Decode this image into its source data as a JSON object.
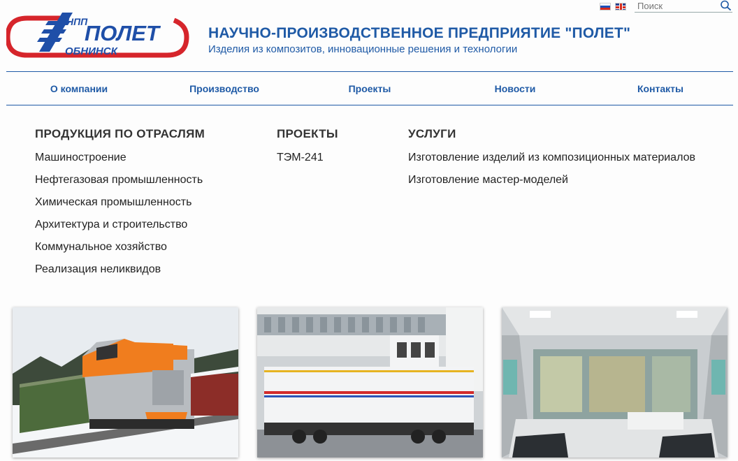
{
  "header": {
    "search_placeholder": "Поиск",
    "title": "НАУЧНО-ПРОИЗВОДСТВЕННОЕ ПРЕДПРИЯТИЕ \"ПОЛЕТ\"",
    "subtitle": "Изделия из композитов, инновационные решения и технологии",
    "logo": {
      "top_text": "НПП",
      "main_text": "ПОЛЕТ",
      "city_text": "ОБНИНСК",
      "brand_blue": "#1f4fa8",
      "brand_red": "#d6252b"
    }
  },
  "nav": {
    "items": [
      {
        "label": "О компании"
      },
      {
        "label": "Производство"
      },
      {
        "label": "Проекты"
      },
      {
        "label": "Новости"
      },
      {
        "label": "Контакты"
      }
    ]
  },
  "menu": {
    "industries": {
      "heading": "ПРОДУКЦИЯ ПО ОТРАСЛЯМ",
      "items": [
        "Машиностроение",
        "Нефтегазовая промышленность",
        "Химическая промышленность",
        "Архитектура и строительство",
        "Коммунальное хозяйство",
        "Реализация неликвидов"
      ]
    },
    "projects": {
      "heading": "ПРОЕКТЫ",
      "items": [
        "ТЭМ-241"
      ]
    },
    "services": {
      "heading": "УСЛУГИ",
      "items": [
        "Изготовление изделий из композиционных материалов",
        "Изготовление мастер-моделей"
      ]
    }
  },
  "colors": {
    "accent": "#1f5aa6",
    "text": "#222222"
  }
}
